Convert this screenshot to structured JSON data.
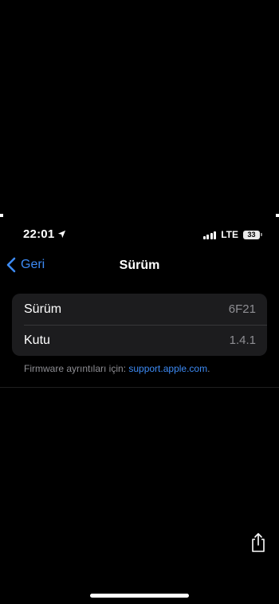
{
  "status_bar": {
    "time": "22:01",
    "network": "LTE",
    "battery": "33"
  },
  "nav": {
    "back_label": "Geri",
    "title": "Sürüm"
  },
  "rows": [
    {
      "label": "Sürüm",
      "value": "6F21"
    },
    {
      "label": "Kutu",
      "value": "1.4.1"
    }
  ],
  "footer": {
    "text": "Firmware ayrıntıları için: ",
    "link": "support.apple.com",
    "suffix": "."
  },
  "colors": {
    "background": "#000000",
    "accent": "#3d8bf5",
    "group_bg": "#1c1c1e",
    "secondary_text": "#8e8e93"
  },
  "icons": {
    "location": "location-arrow-icon",
    "back": "chevron-left-icon",
    "share": "share-icon"
  }
}
